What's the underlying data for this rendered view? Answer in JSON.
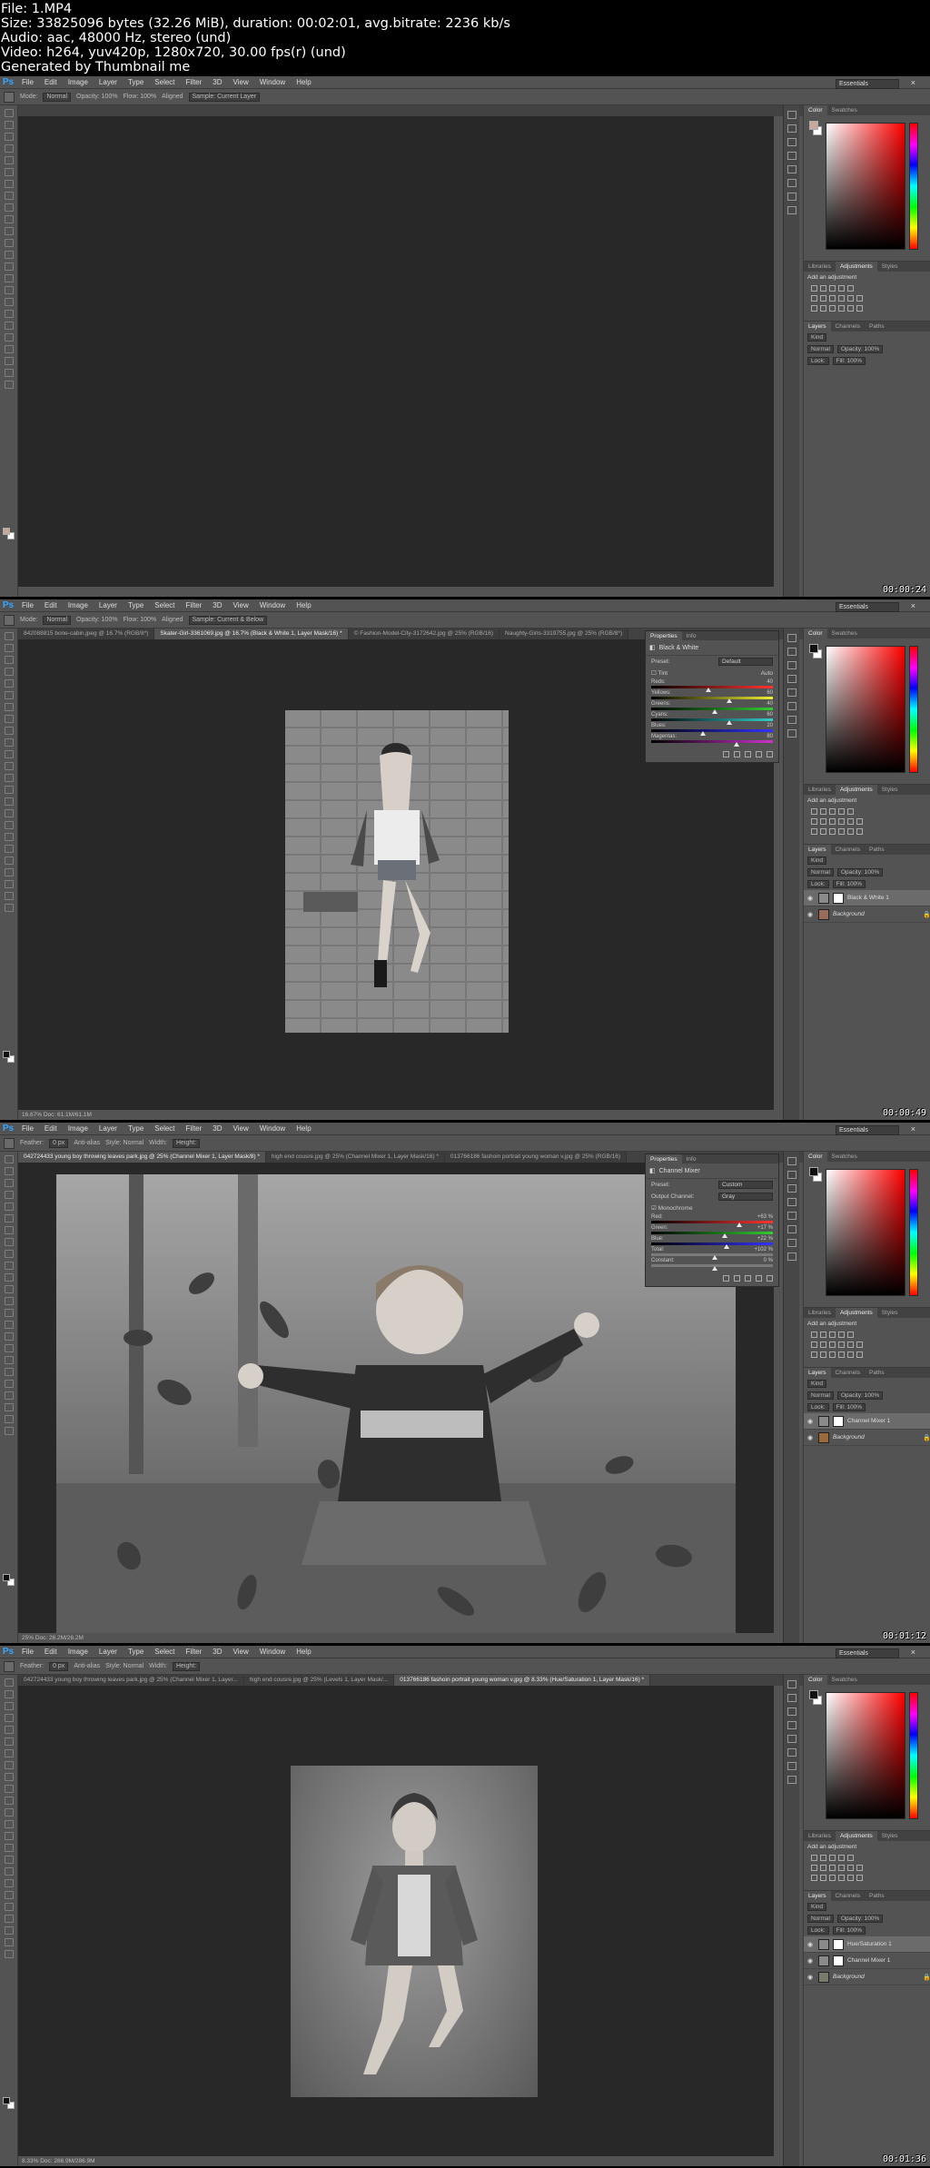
{
  "meta_lines": [
    "File: 1.MP4",
    "Size: 33825096 bytes (32.26 MiB), duration: 00:02:01, avg.bitrate: 2236 kb/s",
    "Audio: aac, 48000 Hz, stereo (und)",
    "Video: h264, yuv420p, 1280x720, 30.00 fps(r) (und)",
    "Generated by Thumbnail me"
  ],
  "app": {
    "logo": "Ps",
    "menu": [
      "File",
      "Edit",
      "Image",
      "Layer",
      "Type",
      "Select",
      "Filter",
      "3D",
      "View",
      "Window",
      "Help"
    ],
    "window_controls": "– □ ×",
    "workspace": "Essentials",
    "colors": {
      "chrome": "#535353",
      "canvas": "#282828",
      "accent": "#31a8ff"
    }
  },
  "panels": {
    "color_tabs": [
      "Color",
      "Swatches"
    ],
    "adj_tabs": [
      "Libraries",
      "Adjustments",
      "Styles"
    ],
    "adj_label": "Add an adjustment",
    "layer_tabs": [
      "Layers",
      "Channels",
      "Paths"
    ],
    "kind": "Kind",
    "blend": "Normal",
    "opacity": "Opacity: 100%",
    "lock": "Lock:",
    "fill": "Fill: 100%"
  },
  "frames": [
    {
      "timestamp": "00:00:24",
      "options": {
        "mode_label": "Mode:",
        "mode": "Normal",
        "opacity": "Opacity: 100%",
        "flow": "Flow: 100%",
        "aligned": "Aligned",
        "sample": "Sample: Current Layer"
      },
      "tabs": [],
      "status": "",
      "layers": [],
      "photo": null,
      "props": null
    },
    {
      "timestamp": "00:00:49",
      "options": {
        "mode_label": "Mode:",
        "mode": "Normal",
        "opacity": "Opacity: 100%",
        "flow": "Flow: 100%",
        "aligned": "Aligned",
        "sample": "Sample: Current & Below"
      },
      "tabs": [
        {
          "label": "842088815 bone-cabin.jpeg @ 16.7% (RGB/8*)",
          "active": false
        },
        {
          "label": "Skater-Girl-3361069.jpg @ 16.7% (Black & White 1, Layer Mask/16) *",
          "active": true
        },
        {
          "label": "© Fashion-Model-City-3172642.jpg @ 25% (RGB/16)",
          "active": false
        },
        {
          "label": "Naughty-Girls-3319755.jpg @ 25% (RGB/8*)",
          "active": false
        }
      ],
      "status": "16.67%   Doc: 61.1M/61.1M",
      "layers": [
        {
          "name": "Black & White 1",
          "selected": true,
          "thumb": "#8a8a8a",
          "mask": true,
          "italic": false
        },
        {
          "name": "Background",
          "selected": false,
          "thumb": "#9a6a5a",
          "mask": false,
          "italic": true
        }
      ],
      "props": {
        "tabs": [
          "Properties",
          "Info"
        ],
        "title": "Black & White",
        "preset_label": "Preset:",
        "preset": "Default",
        "tint": "Tint",
        "auto": "Auto",
        "sliders": [
          {
            "label": "Reds:",
            "value": "40"
          },
          {
            "label": "Yellows:",
            "value": "60"
          },
          {
            "label": "Greens:",
            "value": "40"
          },
          {
            "label": "Cyans:",
            "value": "60"
          },
          {
            "label": "Blues:",
            "value": "20"
          },
          {
            "label": "Magentas:",
            "value": "80"
          }
        ],
        "slider_levels": [
          0.45,
          0.62,
          0.5,
          0.62,
          0.4,
          0.68
        ]
      }
    },
    {
      "timestamp": "00:01:12",
      "options": {
        "mode_label": "Feather:",
        "mode": "0 px",
        "opacity": "Anti-alias",
        "flow": "Style: Normal",
        "aligned": "Width:",
        "sample": "Height:"
      },
      "tabs": [
        {
          "label": "042724433 young boy throwing leaves park.jpg @ 25% (Channel Mixer 1, Layer Mask/8) *",
          "active": true
        },
        {
          "label": "high end cousre.jpg @ 25% (Channel Mixer 1, Layer Mask/16) *",
          "active": false
        },
        {
          "label": "013766186 fashoin portrait young woman v.jpg @ 25% (RGB/16)",
          "active": false
        }
      ],
      "status": "25%   Doc: 26.2M/26.2M",
      "layers": [
        {
          "name": "Channel Mixer 1",
          "selected": true,
          "thumb": "#8a8a8a",
          "mask": true,
          "italic": false
        },
        {
          "name": "Background",
          "selected": false,
          "thumb": "#9a6a3a",
          "mask": false,
          "italic": true
        }
      ],
      "props": {
        "tabs": [
          "Properties",
          "Info"
        ],
        "title": "Channel Mixer",
        "preset_label": "Preset:",
        "preset": "Custom",
        "output_label": "Output Channel:",
        "output": "Gray",
        "mono": "Monochrome",
        "sliders": [
          {
            "label": "Red:",
            "value": "+63",
            "unit": "%"
          },
          {
            "label": "Green:",
            "value": "+17",
            "unit": "%"
          },
          {
            "label": "Blue:",
            "value": "+22",
            "unit": "%"
          },
          {
            "label": "Total:",
            "value": "+102",
            "unit": "%"
          },
          {
            "label": "Constant:",
            "value": "0",
            "unit": "%"
          }
        ],
        "slider_levels": [
          0.7,
          0.58,
          0.6,
          0.5,
          0.5
        ]
      }
    },
    {
      "timestamp": "00:01:36",
      "options": {
        "mode_label": "Feather:",
        "mode": "0 px",
        "opacity": "Anti-alias",
        "flow": "Style: Normal",
        "aligned": "Width:",
        "sample": "Height:"
      },
      "tabs": [
        {
          "label": "042724433 young boy throwing leaves park.jpg @ 25% (Channel Mixer 1, Layer...",
          "active": false
        },
        {
          "label": "high end cousre.jpg @ 25% (Levels 1, Layer Mask/...",
          "active": false
        },
        {
          "label": "013766186 fashoin portrait young woman v.jpg @ 8.33% (Hue/Saturation 1, Layer Mask/16) *",
          "active": true
        }
      ],
      "status": "8.33%   Doc: 286.9M/286.9M",
      "layers": [
        {
          "name": "Hue/Saturation 1",
          "selected": true,
          "thumb": "#8a8a8a",
          "mask": true,
          "italic": false
        },
        {
          "name": "Channel Mixer 1",
          "selected": false,
          "thumb": "#8a8a8a",
          "mask": true,
          "italic": false
        },
        {
          "name": "Background",
          "selected": false,
          "thumb": "#7a7a6a",
          "mask": false,
          "italic": true
        }
      ],
      "props": null
    }
  ]
}
